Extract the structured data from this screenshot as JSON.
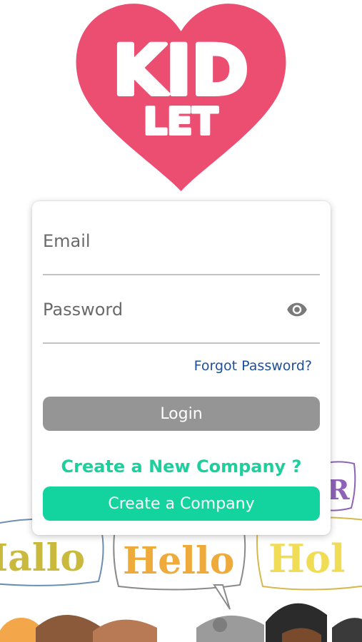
{
  "logo": {
    "line1": "KID",
    "line2": "LET",
    "heart_color": "#ec4e72",
    "text_color": "#ffffff"
  },
  "login_form": {
    "email_placeholder": "Email",
    "password_placeholder": "Password",
    "forgot_password_label": "Forgot Password?",
    "login_label": "Login"
  },
  "company": {
    "heading": "Create a New Company ?",
    "button_label": "Create a Company"
  },
  "background_art": {
    "greetings": [
      "Hallo",
      "Hello",
      "Hol",
      "R"
    ]
  },
  "colors": {
    "accent_green": "#13d39e",
    "link_blue": "#1d4f9c",
    "login_gray": "#959595"
  },
  "icons": {
    "password_visibility": "eye-icon"
  }
}
